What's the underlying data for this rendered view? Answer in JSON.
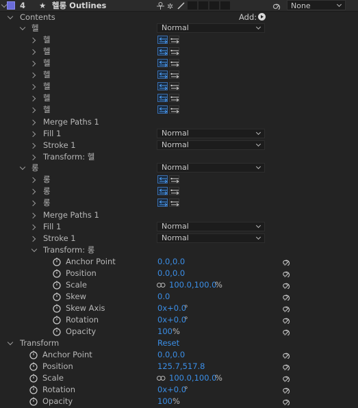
{
  "layer": {
    "number": "4",
    "star": "★",
    "name": "헬롱 Outlines",
    "switch_icons": [
      "puppet-icon",
      "star-sparkle-icon",
      "pen-slash-icon"
    ],
    "parent_value": "None"
  },
  "contents": {
    "label": "Contents",
    "add_label": "Add:",
    "group1": {
      "name": "헬",
      "blend": "Normal",
      "paths": [
        "헬",
        "헬",
        "헬",
        "헬",
        "헬",
        "헬",
        "헬"
      ],
      "merge": "Merge Paths 1",
      "fill_label": "Fill 1",
      "fill_blend": "Normal",
      "stroke_label": "Stroke 1",
      "stroke_blend": "Normal",
      "transform_label": "Transform: 헬"
    },
    "group2": {
      "name": "롱",
      "blend": "Normal",
      "paths": [
        "롱",
        "롱",
        "롱"
      ],
      "merge": "Merge Paths 1",
      "fill_label": "Fill 1",
      "fill_blend": "Normal",
      "stroke_label": "Stroke 1",
      "stroke_blend": "Normal",
      "transform_label": "Transform: 롱",
      "props": {
        "anchor_label": "Anchor Point",
        "anchor_value": "0.0,0.0",
        "position_label": "Position",
        "position_value": "0.0,0.0",
        "scale_label": "Scale",
        "scale_value": "100.0,100.0",
        "scale_unit": "%",
        "skew_label": "Skew",
        "skew_value": "0.0",
        "skew_axis_label": "Skew Axis",
        "skew_axis_value": "0x+0.0",
        "skew_axis_unit": "°",
        "rotation_label": "Rotation",
        "rotation_value": "0x+0.0",
        "rotation_unit": "°",
        "opacity_label": "Opacity",
        "opacity_value": "100",
        "opacity_unit": "%"
      }
    }
  },
  "transform": {
    "label": "Transform",
    "reset": "Reset",
    "anchor_label": "Anchor Point",
    "anchor_value": "0.0,0.0",
    "position_label": "Position",
    "position_value": "125.7,517.8",
    "scale_label": "Scale",
    "scale_value": "100.0,100.0",
    "scale_unit": "%",
    "rotation_label": "Rotation",
    "rotation_value": "0x+0.0",
    "rotation_unit": "°",
    "opacity_label": "Opacity",
    "opacity_value": "100",
    "opacity_unit": "%"
  },
  "colors": {
    "label_color": "#6a6cd8",
    "value_blue": "#3b8fe8",
    "panel_bg": "#232323"
  }
}
